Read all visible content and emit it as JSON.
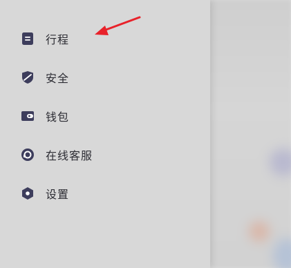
{
  "menu": {
    "items": [
      {
        "label": "行程",
        "icon": "trip-list-icon"
      },
      {
        "label": "安全",
        "icon": "shield-icon"
      },
      {
        "label": "钱包",
        "icon": "wallet-icon"
      },
      {
        "label": "在线客服",
        "icon": "customer-service-icon"
      },
      {
        "label": "设置",
        "icon": "settings-icon"
      }
    ]
  },
  "annotation": {
    "type": "red-arrow",
    "points_to": "行程",
    "color": "#e8222a"
  },
  "colors": {
    "icon": "#3d3d5c",
    "drawer_bg": "#d8d8d8",
    "text": "#2c2c33"
  }
}
